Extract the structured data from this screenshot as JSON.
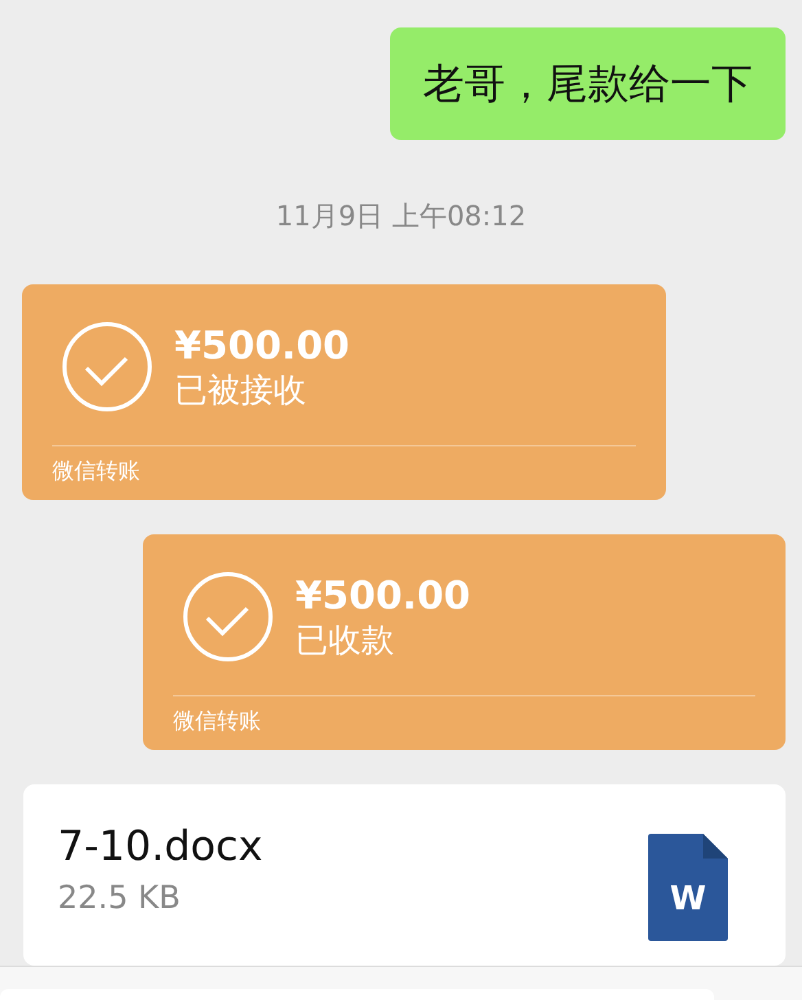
{
  "messages": [
    {
      "kind": "text",
      "outgoing": true,
      "text": "老哥，尾款给一下"
    },
    {
      "kind": "time",
      "text": "11月9日 上午08:12"
    },
    {
      "kind": "transfer",
      "outgoing": false,
      "amount": "¥500.00",
      "status": "已被接收",
      "footer": "微信转账"
    },
    {
      "kind": "transfer",
      "outgoing": true,
      "amount": "¥500.00",
      "status": "已收款",
      "footer": "微信转账"
    },
    {
      "kind": "file",
      "outgoing": true,
      "name": "7-10.docx",
      "size": "22.5 KB",
      "icon_letter": "W"
    }
  ]
}
